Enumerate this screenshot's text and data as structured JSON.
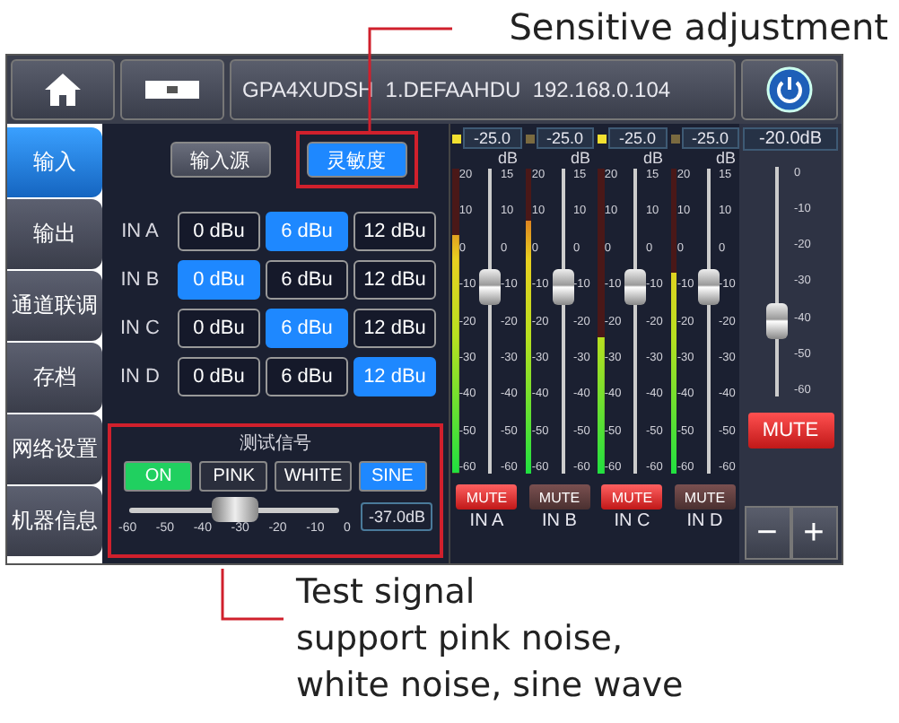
{
  "annotations": {
    "top": "Sensitive adjustment",
    "bottom": [
      "Test signal",
      "support pink noise,",
      "white noise, sine wave"
    ]
  },
  "top_bar": {
    "device_info": "GPA4XUDSH  1.DEFAAHDU  192.168.0.104"
  },
  "nav": [
    {
      "label": "输入",
      "selected": true
    },
    {
      "label": "输出",
      "selected": false
    },
    {
      "label": "通道联调",
      "selected": false
    },
    {
      "label": "存档",
      "selected": false
    },
    {
      "label": "网络设置",
      "selected": false
    },
    {
      "label": "机器信息",
      "selected": false
    }
  ],
  "input_tabs": [
    {
      "label": "输入源",
      "selected": false
    },
    {
      "label": "灵敏度",
      "selected": true
    }
  ],
  "sensitivity": [
    {
      "channel": "IN A",
      "options": [
        {
          "label": "0 dBu",
          "selected": false
        },
        {
          "label": "6 dBu",
          "selected": true
        },
        {
          "label": "12 dBu",
          "selected": false
        }
      ]
    },
    {
      "channel": "IN B",
      "options": [
        {
          "label": "0 dBu",
          "selected": true
        },
        {
          "label": "6 dBu",
          "selected": false
        },
        {
          "label": "12 dBu",
          "selected": false
        }
      ]
    },
    {
      "channel": "IN C",
      "options": [
        {
          "label": "0 dBu",
          "selected": false
        },
        {
          "label": "6 dBu",
          "selected": true
        },
        {
          "label": "12 dBu",
          "selected": false
        }
      ]
    },
    {
      "channel": "IN D",
      "options": [
        {
          "label": "0 dBu",
          "selected": false
        },
        {
          "label": "6 dBu",
          "selected": false
        },
        {
          "label": "12 dBu",
          "selected": true
        }
      ]
    }
  ],
  "test_signal": {
    "title": "测试信号",
    "buttons": [
      {
        "kind": "toggle",
        "label": "ON",
        "on": true
      },
      {
        "kind": "signal",
        "label": "PINK",
        "selected": false
      },
      {
        "kind": "signal",
        "label": "WHITE",
        "selected": false
      },
      {
        "kind": "signal",
        "label": "SINE",
        "selected": true
      }
    ],
    "slider": {
      "level": 0.5,
      "ticks": [
        "-60",
        "-50",
        "-40",
        "-30",
        "-20",
        "-10",
        "0"
      ]
    },
    "reading": "-37.0dB"
  },
  "channels": [
    {
      "reading": "-25.0",
      "unit": "dB",
      "peak": true,
      "meter": {
        "level": 0.78
      },
      "fader": {
        "level": 0.61
      },
      "meter_ticks": [
        "20",
        "10",
        "0",
        "-10",
        "-20",
        "-30",
        "-40",
        "-50",
        "-60"
      ],
      "fader_ticks": [
        "15",
        "10",
        "0",
        "-10",
        "-20",
        "-30",
        "-40",
        "-50",
        "-60"
      ],
      "mute": {
        "label": "MUTE",
        "on": true
      },
      "name": "IN A"
    },
    {
      "reading": "-25.0",
      "unit": "dB",
      "peak": false,
      "meter": {
        "level": 0.83
      },
      "fader": {
        "level": 0.61
      },
      "meter_ticks": [
        "20",
        "10",
        "0",
        "-10",
        "-20",
        "-30",
        "-40",
        "-50",
        "-60"
      ],
      "fader_ticks": [
        "15",
        "10",
        "0",
        "-10",
        "-20",
        "-30",
        "-40",
        "-50",
        "-60"
      ],
      "mute": {
        "label": "MUTE",
        "on": false
      },
      "name": "IN B"
    },
    {
      "reading": "-25.0",
      "unit": "dB",
      "peak": true,
      "meter": {
        "level": 0.45
      },
      "fader": {
        "level": 0.61
      },
      "meter_ticks": [
        "20",
        "10",
        "0",
        "-10",
        "-20",
        "-30",
        "-40",
        "-50",
        "-60"
      ],
      "fader_ticks": [
        "15",
        "10",
        "0",
        "-10",
        "-20",
        "-30",
        "-40",
        "-50",
        "-60"
      ],
      "mute": {
        "label": "MUTE",
        "on": true
      },
      "name": "IN C"
    },
    {
      "reading": "-25.0",
      "unit": "dB",
      "peak": false,
      "meter": {
        "level": 0.66
      },
      "fader": {
        "level": 0.61
      },
      "meter_ticks": [
        "20",
        "10",
        "0",
        "-10",
        "-20",
        "-30",
        "-40",
        "-50",
        "-60"
      ],
      "fader_ticks": [
        "15",
        "10",
        "0",
        "-10",
        "-20",
        "-30",
        "-40",
        "-50",
        "-60"
      ],
      "mute": {
        "label": "MUTE",
        "on": false
      },
      "name": "IN D"
    }
  ],
  "master": {
    "reading": "-20.0dB",
    "fader": {
      "level": 0.33
    },
    "ticks": [
      "0",
      "-10",
      "-20",
      "-30",
      "-40",
      "-50",
      "-60"
    ],
    "mute": {
      "label": "MUTE",
      "on": true
    },
    "buttons": [
      "−",
      "+"
    ]
  }
}
